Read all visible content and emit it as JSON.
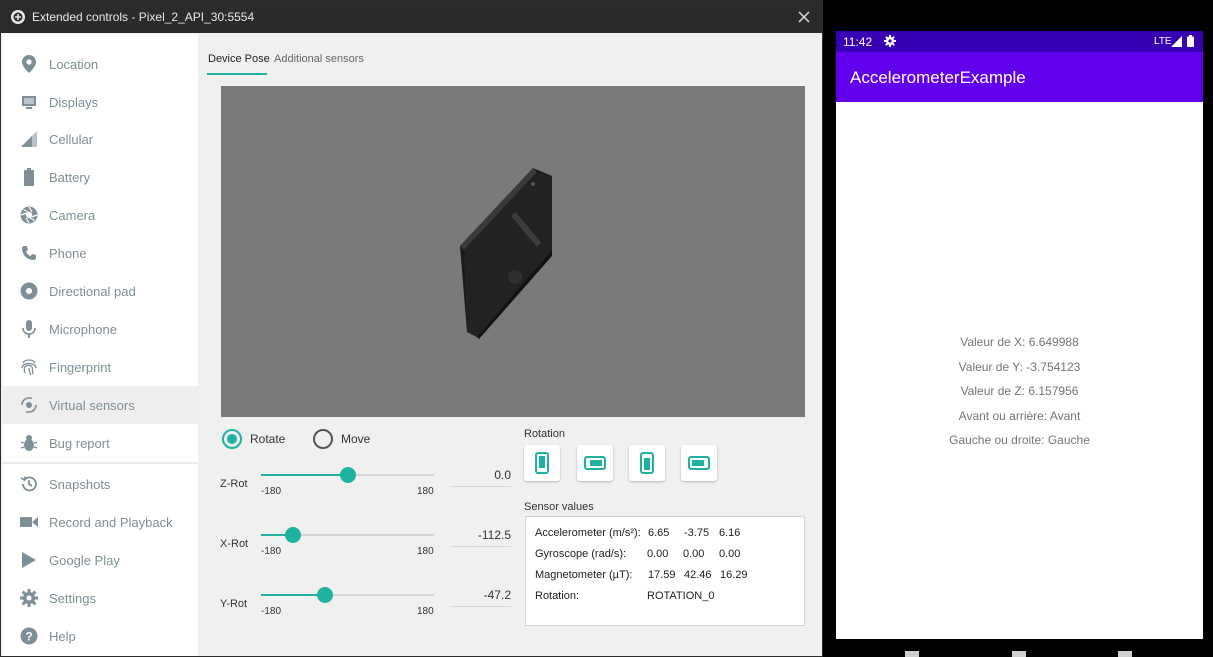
{
  "window": {
    "title": "Extended controls - Pixel_2_API_30:5554"
  },
  "sidebar": {
    "items": [
      {
        "label": "Location",
        "icon": "location-pin-icon"
      },
      {
        "label": "Displays",
        "icon": "display-icon"
      },
      {
        "label": "Cellular",
        "icon": "cellular-signal-icon"
      },
      {
        "label": "Battery",
        "icon": "battery-icon"
      },
      {
        "label": "Camera",
        "icon": "camera-aperture-icon"
      },
      {
        "label": "Phone",
        "icon": "phone-icon"
      },
      {
        "label": "Directional pad",
        "icon": "dpad-icon"
      },
      {
        "label": "Microphone",
        "icon": "microphone-icon"
      },
      {
        "label": "Fingerprint",
        "icon": "fingerprint-icon"
      },
      {
        "label": "Virtual sensors",
        "icon": "rotate-device-icon",
        "active": true
      },
      {
        "label": "Bug report",
        "icon": "bug-icon"
      },
      {
        "label": "Snapshots",
        "icon": "history-icon"
      },
      {
        "label": "Record and Playback",
        "icon": "video-record-icon"
      },
      {
        "label": "Google Play",
        "icon": "play-store-icon"
      },
      {
        "label": "Settings",
        "icon": "gear-icon"
      },
      {
        "label": "Help",
        "icon": "help-icon"
      }
    ]
  },
  "tabs": {
    "device_pose": "Device Pose",
    "additional_sensors": "Additional sensors",
    "active": "Device Pose"
  },
  "mode": {
    "rotate": "Rotate",
    "move": "Move",
    "selected": "Rotate"
  },
  "sliders": [
    {
      "label": "Z-Rot",
      "min": "-180",
      "max": "180",
      "value": "0.0",
      "position": 0.5
    },
    {
      "label": "X-Rot",
      "min": "-180",
      "max": "180",
      "value": "-112.5",
      "position": 0.1875
    },
    {
      "label": "Y-Rot",
      "min": "-180",
      "max": "180",
      "value": "-47.2",
      "position": 0.3689
    }
  ],
  "rotation": {
    "title": "Rotation",
    "buttons": [
      "portrait-icon",
      "landscape-icon",
      "reverse-portrait-icon",
      "reverse-landscape-icon"
    ]
  },
  "sensor_values": {
    "title": "Sensor values",
    "rows": [
      {
        "name": "Accelerometer (m/s²):",
        "values": [
          "6.65",
          "-3.75",
          "6.16"
        ]
      },
      {
        "name": "Gyroscope (rad/s):",
        "values": [
          "0.00",
          "0.00",
          "0.00"
        ]
      },
      {
        "name": "Magnetometer (µT):",
        "values": [
          "17.59",
          "42.46",
          "16.29"
        ]
      },
      {
        "name": "Rotation:",
        "values": [
          "ROTATION_0"
        ]
      }
    ]
  },
  "phone": {
    "time": "11:42",
    "network": "LTE",
    "app_title": "AccelerometerExample",
    "lines": [
      "Valeur de X: 6.649988",
      "Valeur de Y: -3.754123",
      "Valeur de Z: 6.157956",
      "Avant ou arrière: Avant",
      "Gauche ou droite: Gauche"
    ]
  },
  "colors": {
    "accent": "#20b2a0",
    "status_bar": "#3700b3",
    "app_bar": "#6200ee"
  }
}
